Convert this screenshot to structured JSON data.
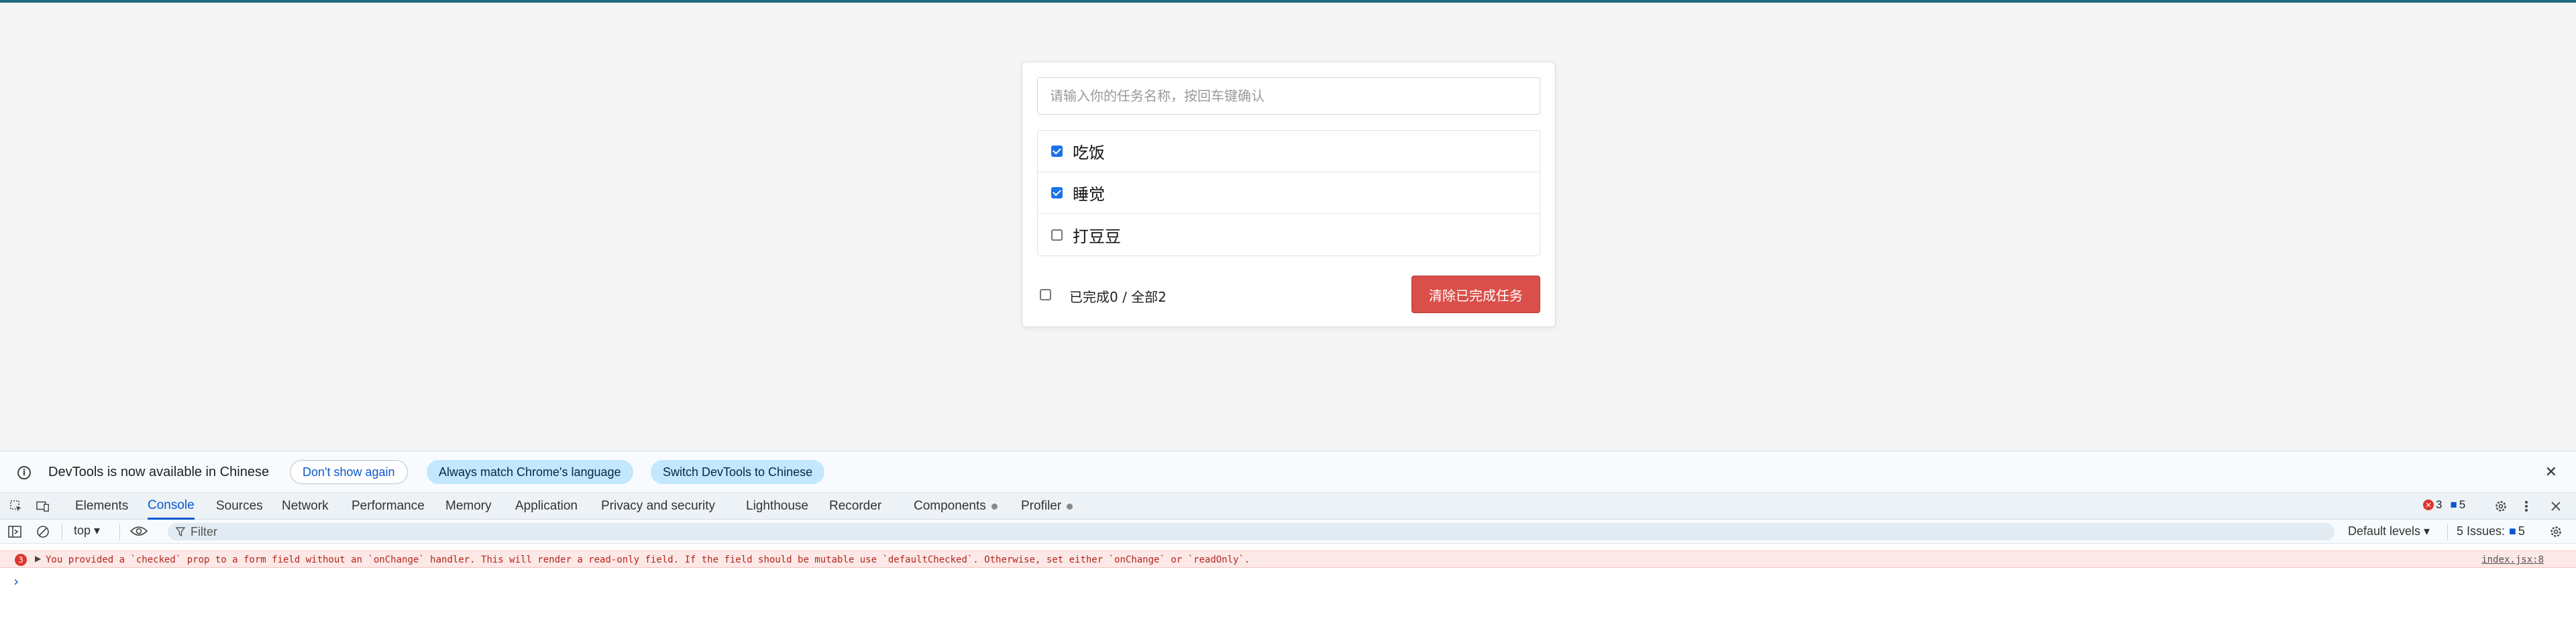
{
  "app": {
    "input": {
      "placeholder": "请输入你的任务名称，按回车键确认",
      "value": ""
    },
    "tasks": [
      {
        "label": "吃饭",
        "checked": true
      },
      {
        "label": "睡觉",
        "checked": true
      },
      {
        "label": "打豆豆",
        "checked": false
      }
    ],
    "footer": {
      "summary": "已完成0 / 全部2",
      "select_all_checked": false,
      "clear_label": "清除已完成任务"
    },
    "colors": {
      "accent_line": "#1e6b7b",
      "clear_button": "#da4f49",
      "checkbox": "#1a73e8"
    }
  },
  "devtools": {
    "infobar": {
      "message": "DevTools is now available in Chinese",
      "dont_show": "Don't show again",
      "match_language": "Always match Chrome's language",
      "switch_language": "Switch DevTools to Chinese",
      "close_glyph": "✕",
      "info_glyph": "i"
    },
    "tabs": [
      {
        "label": "Elements"
      },
      {
        "label": "Console",
        "active": true
      },
      {
        "label": "Sources"
      },
      {
        "label": "Network"
      },
      {
        "label": "Performance"
      },
      {
        "label": "Memory"
      },
      {
        "label": "Application"
      },
      {
        "label": "Privacy and security"
      },
      {
        "label": "Lighthouse"
      },
      {
        "label": "Recorder"
      },
      {
        "label": "Components"
      },
      {
        "label": "Profiler"
      }
    ],
    "counts": {
      "errors": "3",
      "messages": "5"
    },
    "filterbar": {
      "context": "top ▾",
      "filter_placeholder": "Filter",
      "levels": "Default levels ▾",
      "issues_label": "5 Issues:",
      "issues_count": "5"
    },
    "console": {
      "error_count": "3",
      "error_message": "You provided a `checked` prop to a form field without an `onChange` handler. This will render a read-only field. If the field should be mutable use `defaultChecked`. Otherwise, set either `onChange` or `readOnly`.",
      "error_source": "index.jsx:8",
      "prompt": "›"
    }
  }
}
